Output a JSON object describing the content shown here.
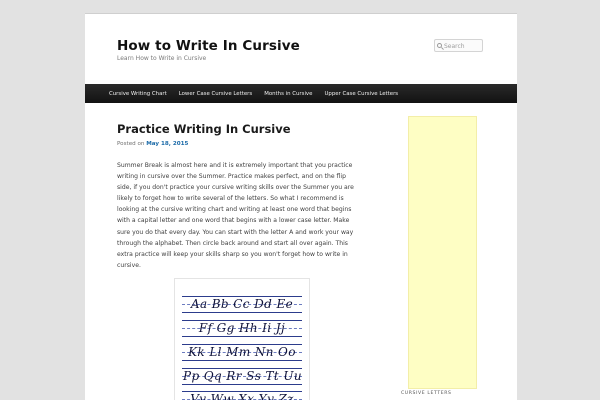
{
  "site": {
    "title": "How to Write In Cursive",
    "description": "Learn How to Write in Cursive"
  },
  "search": {
    "placeholder": "Search"
  },
  "nav": {
    "items": [
      "Cursive Writing Chart",
      "Lower Case Cursive Letters",
      "Months in Cursive",
      "Upper Case Cursive Letters"
    ]
  },
  "post": {
    "title": "Practice Writing In Cursive",
    "meta_prefix": "Posted on",
    "date": "May 18, 2015",
    "body_lines": [
      "Summer Break is almost here and it is extremely important that you practice",
      "writing in cursive over the Summer.  Practice makes perfect, and on the flip",
      "side, if you don't practice your cursive writing skills over the Summer you are",
      "likely to forget how to write several of the letters.  So what I recommend is",
      "looking at the cursive writing chart and writing at least one word that begins",
      "with a capital letter and one word that begins with a lower case letter.  Make",
      "sure you do that every day.  You can start with the letter A and work your way",
      "through the alphabet.  Then circle back around and start all over again.  This",
      "extra practice will keep your skills sharp so you won't forget how to write in",
      "cursive."
    ]
  },
  "chart_image": {
    "rows": [
      "Aa Bb Cc Dd Ee",
      "Ff Gg Hh Ii Jj",
      "Kk Ll Mm Nn Oo",
      "Pp Qq Rr Ss Tt Uu",
      "Vv Ww Xx Yy Zz"
    ]
  },
  "sidebar": {
    "heading": "CURSIVE LETTERS",
    "widget_color": "#fefec4"
  },
  "colors": {
    "nav_background": "#1e1e1e",
    "link": "#1b6aa8",
    "page_background": "#e2e2e2"
  }
}
